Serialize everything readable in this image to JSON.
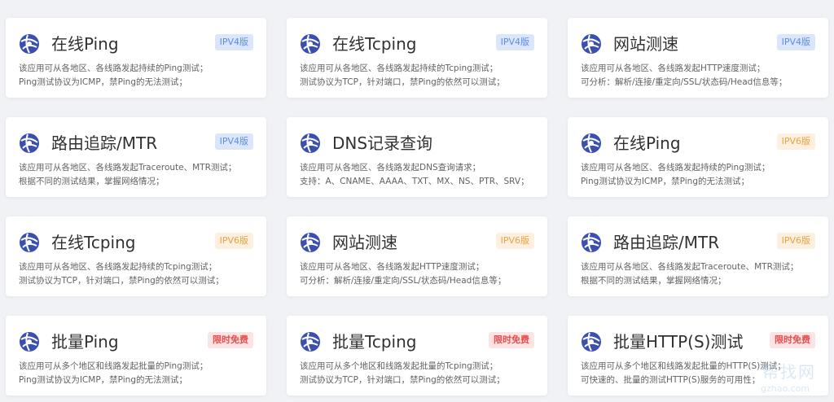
{
  "colors": {
    "ipv4_badge_bg": "#dce6fb",
    "ipv4_badge_text": "#5b8bef",
    "ipv6_badge_bg": "#fdf0e0",
    "ipv6_badge_text": "#eca23f",
    "free_badge_bg": "#fde4e4",
    "free_badge_text": "#e74c4c",
    "logo": "#3a4fae"
  },
  "cards": [
    {
      "title": "在线Ping",
      "badge": "IPV4版",
      "badge_type": "v4",
      "icon": "globe-link-icon",
      "desc": [
        "该应用可从各地区、各线路发起持续的Ping测试；",
        "Ping测试协议为ICMP，禁Ping的无法测试；"
      ]
    },
    {
      "title": "在线Tcping",
      "badge": "IPV4版",
      "badge_type": "v4",
      "icon": "globe-link-icon",
      "desc": [
        "该应用可从各地区、各线路发起持续的Tcping测试；",
        "测试协议为TCP，针对端口，禁Ping的依然可以测试；"
      ]
    },
    {
      "title": "网站测速",
      "badge": "IPV4版",
      "badge_type": "v4",
      "icon": "globe-link-icon",
      "desc": [
        "该应用可从各地区、各线路发起HTTP速度测试；",
        "可分析：解析/连接/重定向/SSL/状态码/Head信息等；"
      ]
    },
    {
      "title": "路由追踪/MTR",
      "badge": "IPV4版",
      "badge_type": "v4",
      "icon": "globe-link-icon",
      "desc": [
        "该应用可从各地区、各线路发起Traceroute、MTR测试；",
        "根据不同的测试结果，掌握网络情况；"
      ]
    },
    {
      "title": "DNS记录查询",
      "badge": "",
      "badge_type": "none",
      "icon": "globe-link-icon",
      "desc": [
        "该应用可从各地区、各线路发起DNS查询请求；",
        "支持：A、CNAME、AAAA、TXT、MX、NS、PTR、SRV；"
      ]
    },
    {
      "title": "在线Ping",
      "badge": "IPV6版",
      "badge_type": "v6",
      "icon": "globe-link-icon",
      "desc": [
        "该应用可从各地区、各线路发起持续的Ping测试；",
        "Ping测试协议为ICMP，禁Ping的无法测试；"
      ]
    },
    {
      "title": "在线Tcping",
      "badge": "IPV6版",
      "badge_type": "v6",
      "icon": "globe-link-icon",
      "desc": [
        "该应用可从各地区、各线路发起持续的Tcping测试；",
        "测试协议为TCP，针对端口，禁Ping的依然可以测试；"
      ]
    },
    {
      "title": "网站测速",
      "badge": "IPV6版",
      "badge_type": "v6",
      "icon": "globe-link-icon",
      "desc": [
        "该应用可从各地区、各线路发起HTTP速度测试；",
        "可分析：解析/连接/重定向/SSL/状态码/Head信息等；"
      ]
    },
    {
      "title": "路由追踪/MTR",
      "badge": "IPV6版",
      "badge_type": "v6",
      "icon": "globe-link-icon",
      "desc": [
        "该应用可从各地区、各线路发起Traceroute、MTR测试；",
        "根据不同的测试结果，掌握网络情况；"
      ]
    },
    {
      "title": "批量Ping",
      "badge": "限时免费",
      "badge_type": "free",
      "icon": "globe-link-icon",
      "desc": [
        "该应用可从多个地区和线路发起批量的Ping测试；",
        "Ping测试协议为ICMP，禁Ping的无法测试；"
      ]
    },
    {
      "title": "批量Tcping",
      "badge": "限时免费",
      "badge_type": "free",
      "icon": "globe-link-icon",
      "desc": [
        "该应用可从多个地区和线路发起批量的Tcping测试；",
        "测试协议为TCP，针对端口，禁Ping的依然可以测试；"
      ]
    },
    {
      "title": "批量HTTP(S)测试",
      "badge": "限时免费",
      "badge_type": "free",
      "icon": "globe-link-icon",
      "desc": [
        "该应用可从多个地区和线路发起批量的HTTP(S)测试；",
        "可快速的、批量的测试HTTP(S)服务的可用性；"
      ]
    }
  ],
  "watermark": {
    "text": "帮找网",
    "sub": "gzhao.com"
  }
}
